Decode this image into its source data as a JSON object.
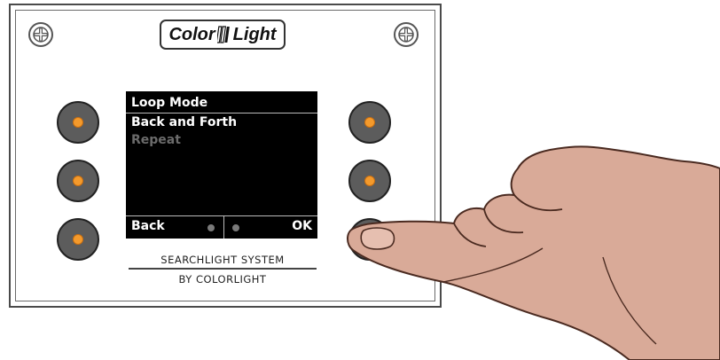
{
  "brand": {
    "left": "Color",
    "right": "Light"
  },
  "screen": {
    "title": "Loop Mode",
    "options": [
      {
        "label": "Back and Forth",
        "selected": true
      },
      {
        "label": "Repeat",
        "selected": false
      }
    ],
    "softkeys": {
      "left": "Back",
      "right": "OK"
    }
  },
  "caption": {
    "line1": "SEARCHLIGHT SYSTEM",
    "line2": "BY COLORLIGHT"
  },
  "colors": {
    "button_face": "#5c5c5c",
    "button_led": "#f49a2c",
    "skin": "#d9aa98"
  }
}
